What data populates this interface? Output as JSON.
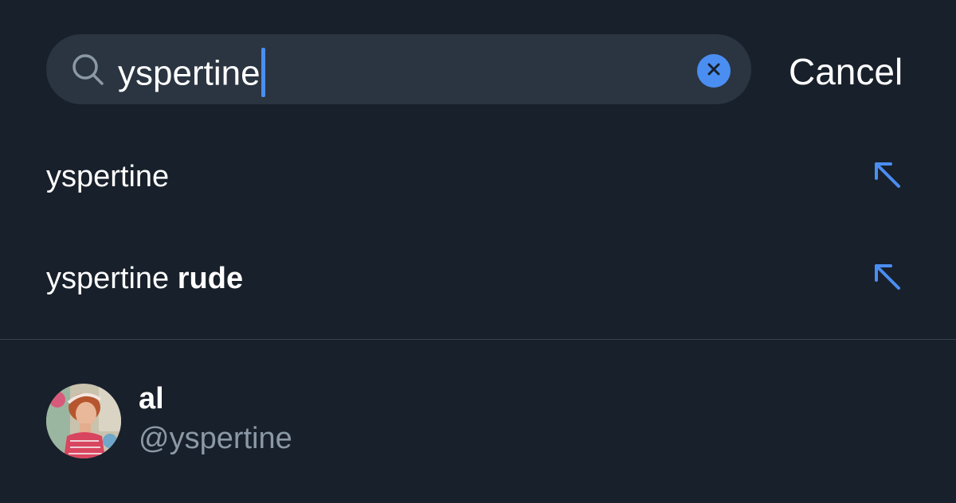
{
  "search": {
    "query": "yspertine",
    "cancel_label": "Cancel"
  },
  "suggestions": [
    {
      "plain": "yspertine",
      "bold": ""
    },
    {
      "plain": "yspertine ",
      "bold": "rude"
    }
  ],
  "user_result": {
    "name": "al",
    "handle": "@yspertine"
  },
  "colors": {
    "background": "#18202b",
    "search_field": "#2b3541",
    "accent": "#4a8ef2",
    "secondary_text": "#8b98a5"
  },
  "icons": {
    "search": "search-icon",
    "clear": "clear-icon",
    "fill_suggestion": "arrow-up-left-icon"
  }
}
